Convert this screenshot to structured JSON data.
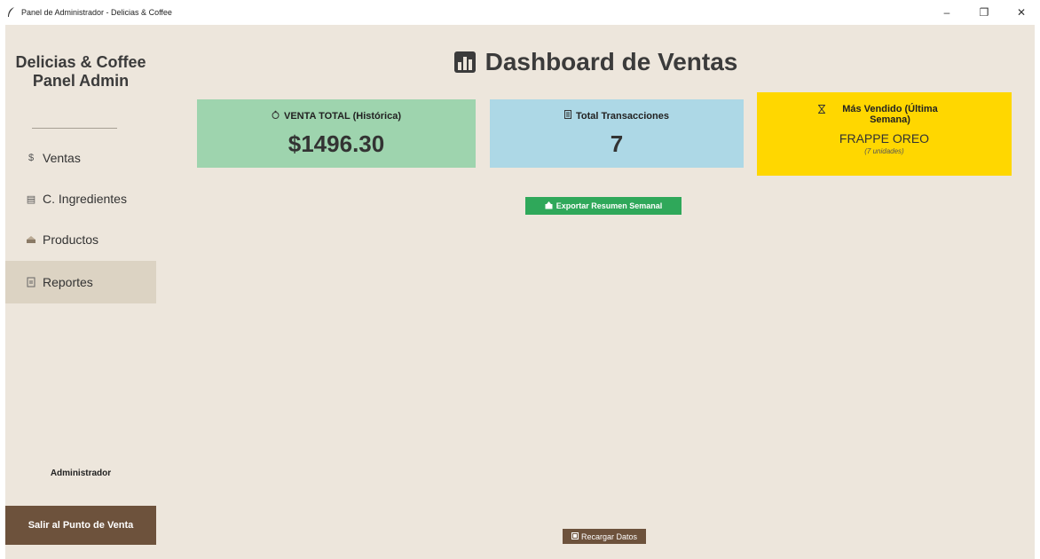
{
  "window": {
    "title": "Panel de Administrador - Delicias & Coffee",
    "controls": {
      "minimize": "–",
      "maximize": "❐",
      "close": "✕"
    }
  },
  "sidebar": {
    "brand_line1": "Delicias & Coffee",
    "brand_line2": "Panel Admin",
    "items": [
      {
        "icon": "dollar-icon",
        "glyph": "$",
        "label": "Ventas",
        "active": false
      },
      {
        "icon": "clipboard-icon",
        "glyph": "▤",
        "label": "C. Ingredientes",
        "active": false
      },
      {
        "icon": "cake-icon",
        "glyph": "🍰",
        "label": "Productos",
        "active": false
      },
      {
        "icon": "document-icon",
        "glyph": "▯",
        "label": "Reportes",
        "active": true
      }
    ],
    "user_role": "Administrador",
    "exit_label": "Salir al Punto de Venta"
  },
  "main": {
    "title": "Dashboard de Ventas",
    "cards": {
      "total_sales": {
        "icon": "money-bag-icon",
        "glyph": "💰",
        "label": "VENTA TOTAL (Histórica)",
        "value": "$1496.30",
        "color": "#9ed4ae"
      },
      "transactions": {
        "icon": "receipt-icon",
        "glyph": "🧾",
        "label": "Total Transacciones",
        "value": "7",
        "color": "#add8e6"
      },
      "top_seller": {
        "icon": "hourglass-icon",
        "glyph": "⌛",
        "label": "Más Vendido (Última Semana)",
        "value": "FRAPPE OREO",
        "sub": "(7 unidades)",
        "color": "#ffd700"
      }
    },
    "export_button": {
      "icon": "export-icon",
      "glyph": "⬆",
      "label": "Exportar Resumen Semanal",
      "color": "#2fa85a"
    },
    "reload_button": {
      "icon": "reload-icon",
      "glyph": "▣",
      "label": "Recargar Datos",
      "color": "#6d523c"
    }
  },
  "colors": {
    "background": "#ede6dc",
    "active_nav": "#dcd3c3",
    "accent_brown": "#6d523c"
  }
}
